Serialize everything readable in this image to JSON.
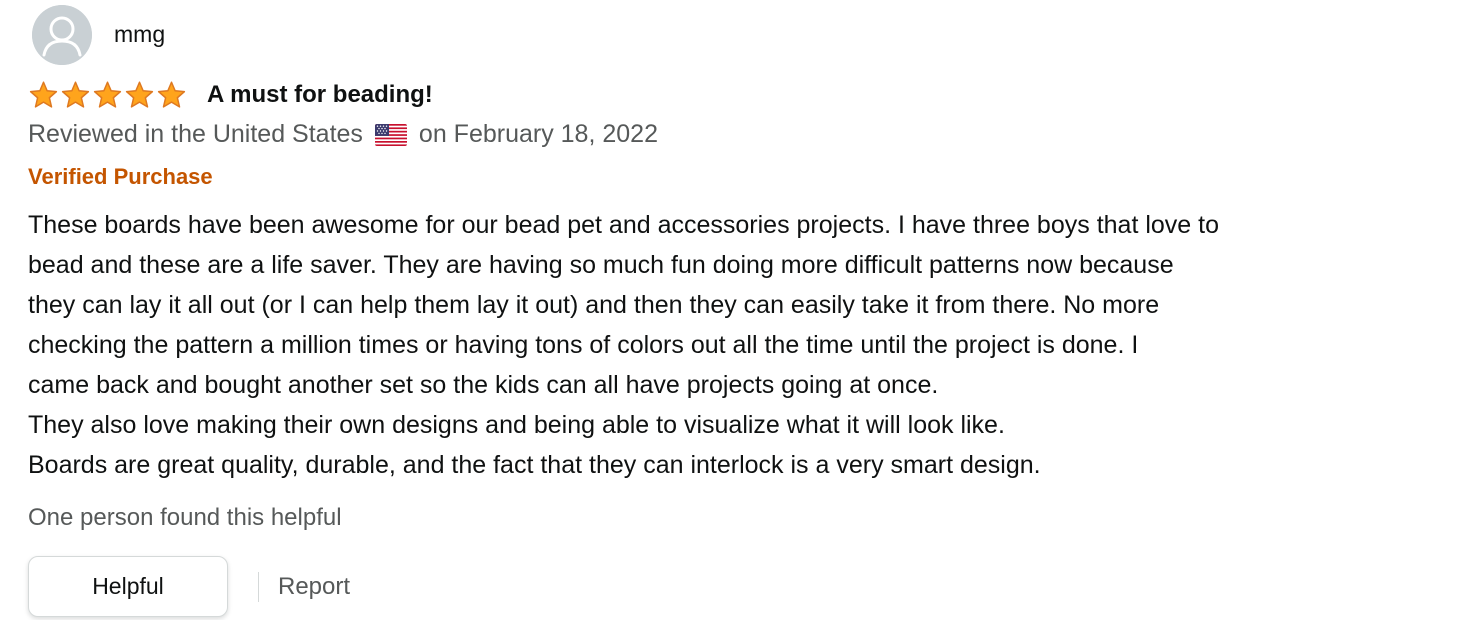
{
  "review": {
    "profile_name": "mmg",
    "avatar_icon": "user-avatar-icon",
    "rating": 5,
    "rating_max": 5,
    "star_color": "#ffa41c",
    "title": "A must for beading!",
    "meta_prefix": "Reviewed in the United States",
    "flag_icon": "us-flag-icon",
    "meta_suffix": "on February 18, 2022",
    "verified": "Verified Purchase",
    "verified_color": "#c45500",
    "body_lines": [
      "These boards have been awesome for our bead pet and accessories projects. I have three boys that love to",
      "bead and these are a life saver. They are having so much fun doing more difficult patterns now because",
      "they can lay it all out (or I can help them lay it out) and then they can easily take it from there. No more",
      "checking the pattern a million times or having tons of colors out all the time until the project is done. I",
      "came back and bought another set so the kids can all have projects going at once.",
      "They also love making their own designs and being able to visualize what it will look like.",
      "Boards are great quality, durable, and the fact that they can interlock is a very smart design."
    ],
    "helpful_count": "One person found this helpful",
    "helpful_button": "Helpful",
    "report_link": "Report"
  }
}
